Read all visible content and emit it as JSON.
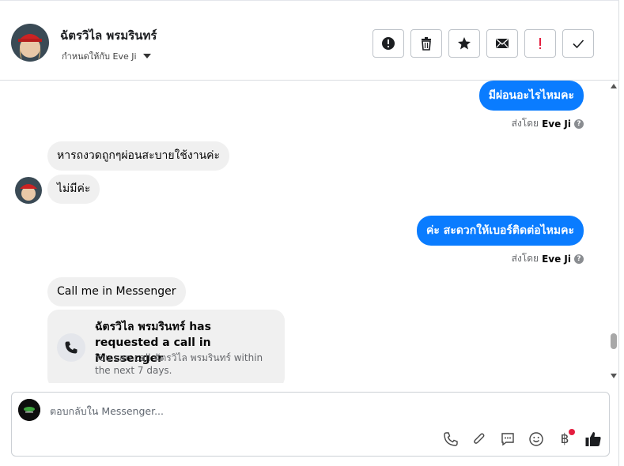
{
  "contact": {
    "name": "ฉัตรวิไล พรมรินทร์",
    "assigned_label": "กำหนดให้กับ Eve Ji"
  },
  "toolbar": {
    "icons": [
      "report-spam-icon",
      "trash-icon",
      "star-icon",
      "envelope-icon",
      "exclamation-icon",
      "check-icon"
    ]
  },
  "messages": {
    "out1": "มีผ่อนอะไรไหมคะ",
    "sent_by_label": "ส่งโดย",
    "sent_by_name": "Eve Ji",
    "in1": "หารถงวดถูกๆผ่อนสะบายใช้งานค่ะ",
    "in2": "ไม่มีค่ะ",
    "out2": "ค่ะ สะดวกให้เบอร์ติดต่อไหมคะ",
    "in3": "Call me in Messenger"
  },
  "call_request": {
    "title": "ฉัตรวิไล พรมรินทร์ has requested a call in Messenger",
    "subtitle": "You can call ฉัตรวิไล พรมรินทร์ within the next 7 days."
  },
  "composer": {
    "placeholder": "ตอบกลับใน Messenger..."
  },
  "colors": {
    "outgoing_bubble": "#0a7cff",
    "incoming_bubble": "#f0f0f0",
    "notification_dot": "#e41e3f"
  }
}
